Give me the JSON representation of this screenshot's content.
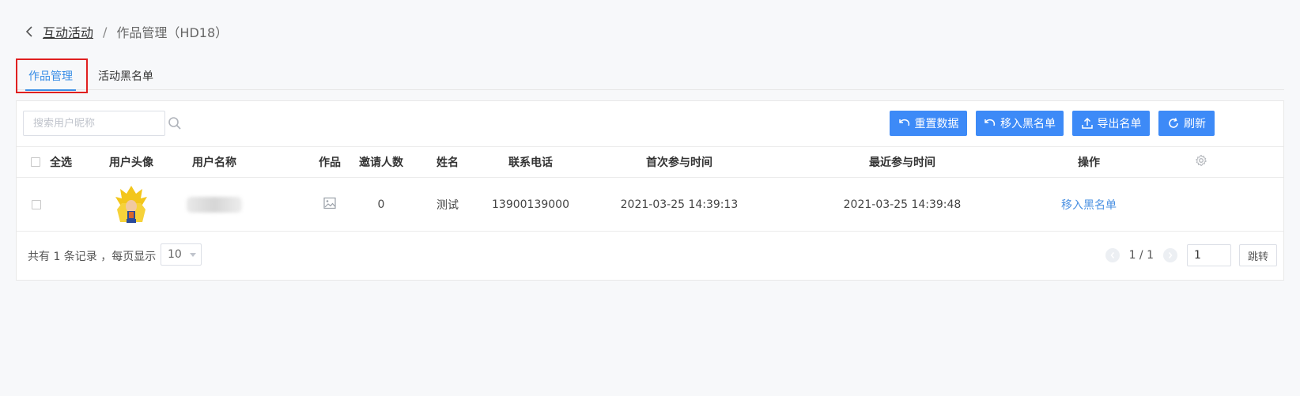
{
  "breadcrumb": {
    "parent": "互动活动",
    "separator": "/",
    "current": "作品管理（HD18）"
  },
  "tabs": [
    {
      "label": "作品管理",
      "active": true
    },
    {
      "label": "活动黑名单",
      "active": false
    }
  ],
  "search": {
    "placeholder": "搜索用户昵称",
    "value": ""
  },
  "toolbar": {
    "reset_label": "重置数据",
    "blacklist_label": "移入黑名单",
    "export_label": "导出名单",
    "refresh_label": "刷新"
  },
  "table": {
    "columns": {
      "select_all": "全选",
      "avatar": "用户头像",
      "username": "用户名称",
      "work": "作品",
      "invites": "邀请人数",
      "name": "姓名",
      "phone": "联系电话",
      "first_time": "首次参与时间",
      "last_time": "最近参与时间",
      "actions": "操作"
    },
    "rows": [
      {
        "invites": "0",
        "name": "测试",
        "phone": "13900139000",
        "first_time": "2021-03-25 14:39:13",
        "last_time": "2021-03-25 14:39:48",
        "action": "移入黑名单"
      }
    ]
  },
  "pagination": {
    "total_text": "共有 1 条记录 ，每页显示",
    "page_size": "10",
    "page_info": "1 / 1",
    "jump_value": "1",
    "jump_label": "跳转"
  },
  "colors": {
    "primary": "#3d8af7",
    "link": "#4a90e2",
    "highlight_border": "#e02020"
  }
}
